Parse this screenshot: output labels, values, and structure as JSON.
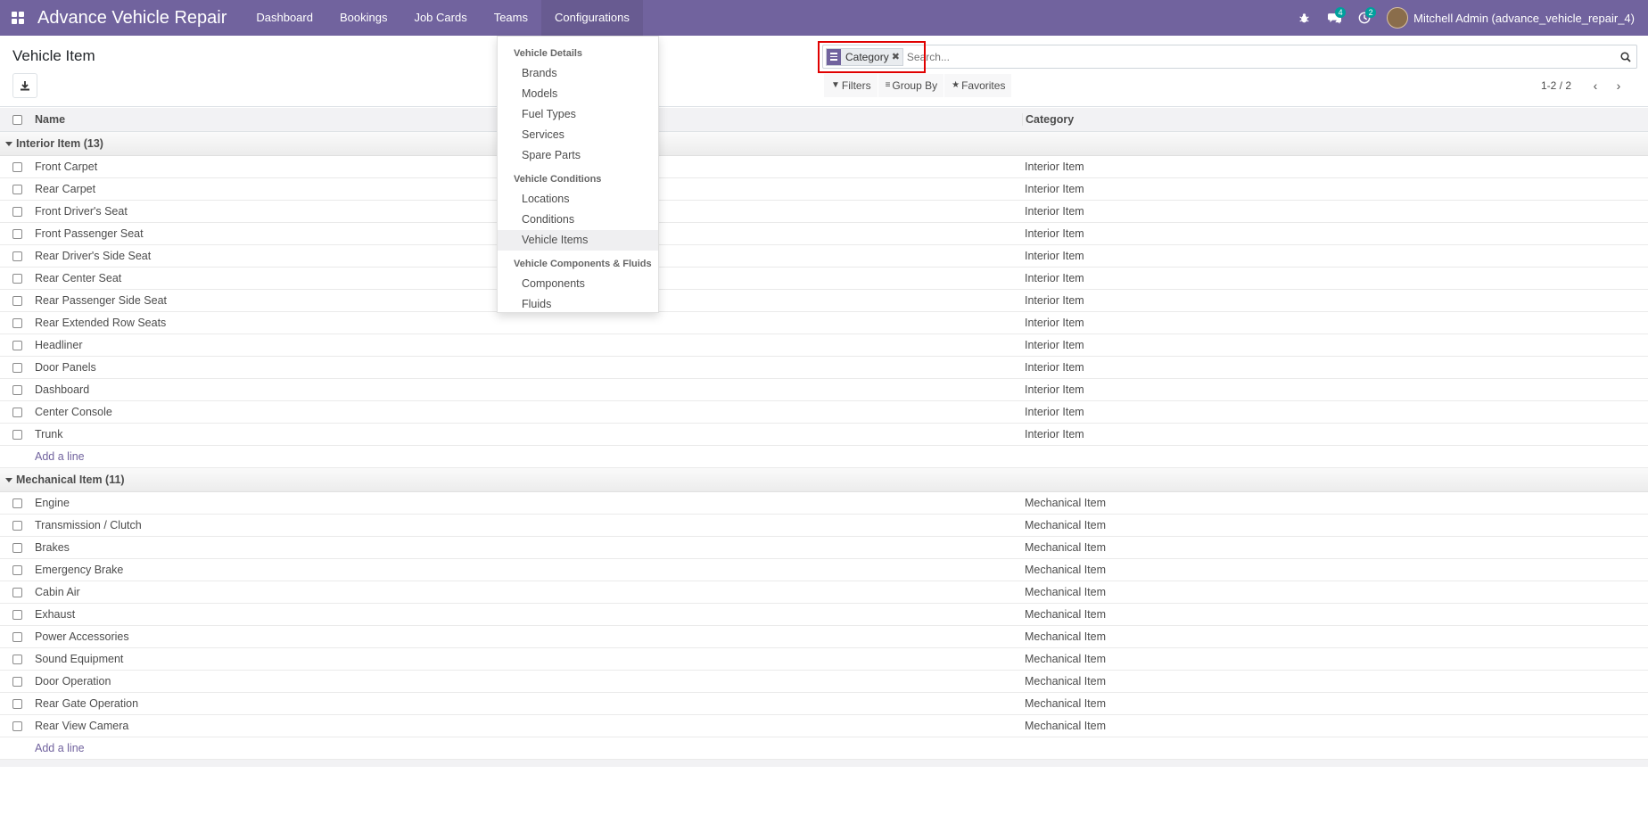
{
  "navbar": {
    "brand": "Advance Vehicle Repair",
    "menu": [
      "Dashboard",
      "Bookings",
      "Job Cards",
      "Teams",
      "Configurations"
    ],
    "messages_count": "4",
    "activities_count": "2",
    "user": "Mitchell Admin (advance_vehicle_repair_4)"
  },
  "control": {
    "title": "Vehicle Item",
    "facet_label": "Category",
    "search_placeholder": "Search...",
    "filters_label": "Filters",
    "groupby_label": "Group By",
    "favorites_label": "Favorites",
    "pager_value": "1-2 / 2"
  },
  "list": {
    "col_name": "Name",
    "col_category": "Category",
    "add_line": "Add a line",
    "groups": [
      {
        "label": "Interior Item (13)",
        "category": "Interior Item",
        "rows": [
          "Front Carpet",
          "Rear Carpet",
          "Front Driver's Seat",
          "Front Passenger Seat",
          "Rear Driver's Side Seat",
          "Rear Center Seat",
          "Rear Passenger Side Seat",
          "Rear Extended Row Seats",
          "Headliner",
          "Door Panels",
          "Dashboard",
          "Center Console",
          "Trunk"
        ]
      },
      {
        "label": "Mechanical Item (11)",
        "category": "Mechanical Item",
        "rows": [
          "Engine",
          "Transmission / Clutch",
          "Brakes",
          "Emergency Brake",
          "Cabin Air",
          "Exhaust",
          "Power Accessories",
          "Sound Equipment",
          "Door Operation",
          "Rear Gate Operation",
          "Rear View Camera"
        ]
      }
    ]
  },
  "dropdown": {
    "sections": [
      {
        "header": "Vehicle Details",
        "items": [
          "Brands",
          "Models",
          "Fuel Types",
          "Services",
          "Spare Parts"
        ]
      },
      {
        "header": "Vehicle Conditions",
        "items": [
          "Locations",
          "Conditions",
          "Vehicle Items"
        ]
      },
      {
        "header": "Vehicle Components & Fluids",
        "items": [
          "Components",
          "Fluids"
        ]
      }
    ],
    "active_item": "Vehicle Items"
  }
}
